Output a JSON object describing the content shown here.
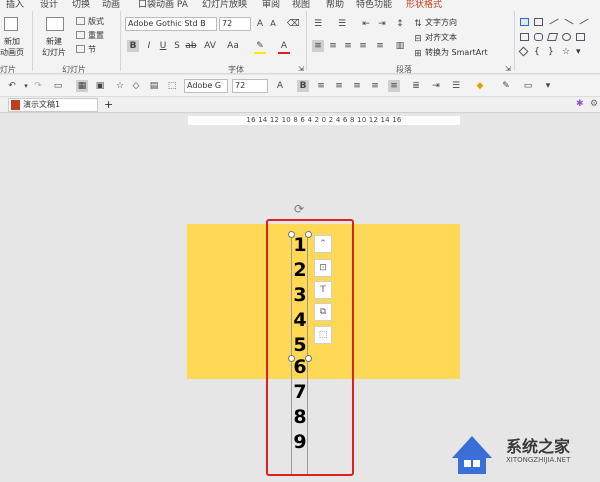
{
  "tabs": [
    {
      "label": "插入"
    },
    {
      "label": "设计"
    },
    {
      "label": "切换"
    },
    {
      "label": "动画"
    },
    {
      "label": "口袋动画 PA"
    },
    {
      "label": "幻灯片放映"
    },
    {
      "label": "审阅"
    },
    {
      "label": "视图"
    },
    {
      "label": "帮助"
    },
    {
      "label": "特色功能"
    },
    {
      "label": "形状格式"
    }
  ],
  "ribbon": {
    "new_slide_home": {
      "line1": "新加",
      "line2": "动画页"
    },
    "new_slide": {
      "line1": "新建",
      "line2": "幻灯片"
    },
    "layout": "版式",
    "reset": "重置",
    "section": "节",
    "group_left": "灯片",
    "group_slides": "幻灯片",
    "font_name": "Adobe Gothic Std B",
    "font_size": "72",
    "group_font": "字体",
    "text_direction": "文字方向",
    "align_text": "对齐文本",
    "convert_smartart": "转换为 SmartArt",
    "group_paragraph": "段落"
  },
  "qat": {
    "font_name": "Adobe G",
    "font_size": "72"
  },
  "doc": {
    "tab_title": "演示文稿1",
    "new_tab": "+"
  },
  "ruler": {
    "text": "16 14 12 10 8 6 4 2 0 2 4 6 8 10 12 14 16"
  },
  "digits": [
    "1",
    "2",
    "3",
    "4",
    "5",
    "6",
    "7",
    "8",
    "9"
  ],
  "watermark": {
    "name": "系统之家",
    "url": "XITONGZHIJIA.NET"
  },
  "colors": {
    "slide": "#ffd955",
    "highlight": "#e02020",
    "accent_tab": "#c43e1c",
    "logo": "#3a6fd8"
  }
}
